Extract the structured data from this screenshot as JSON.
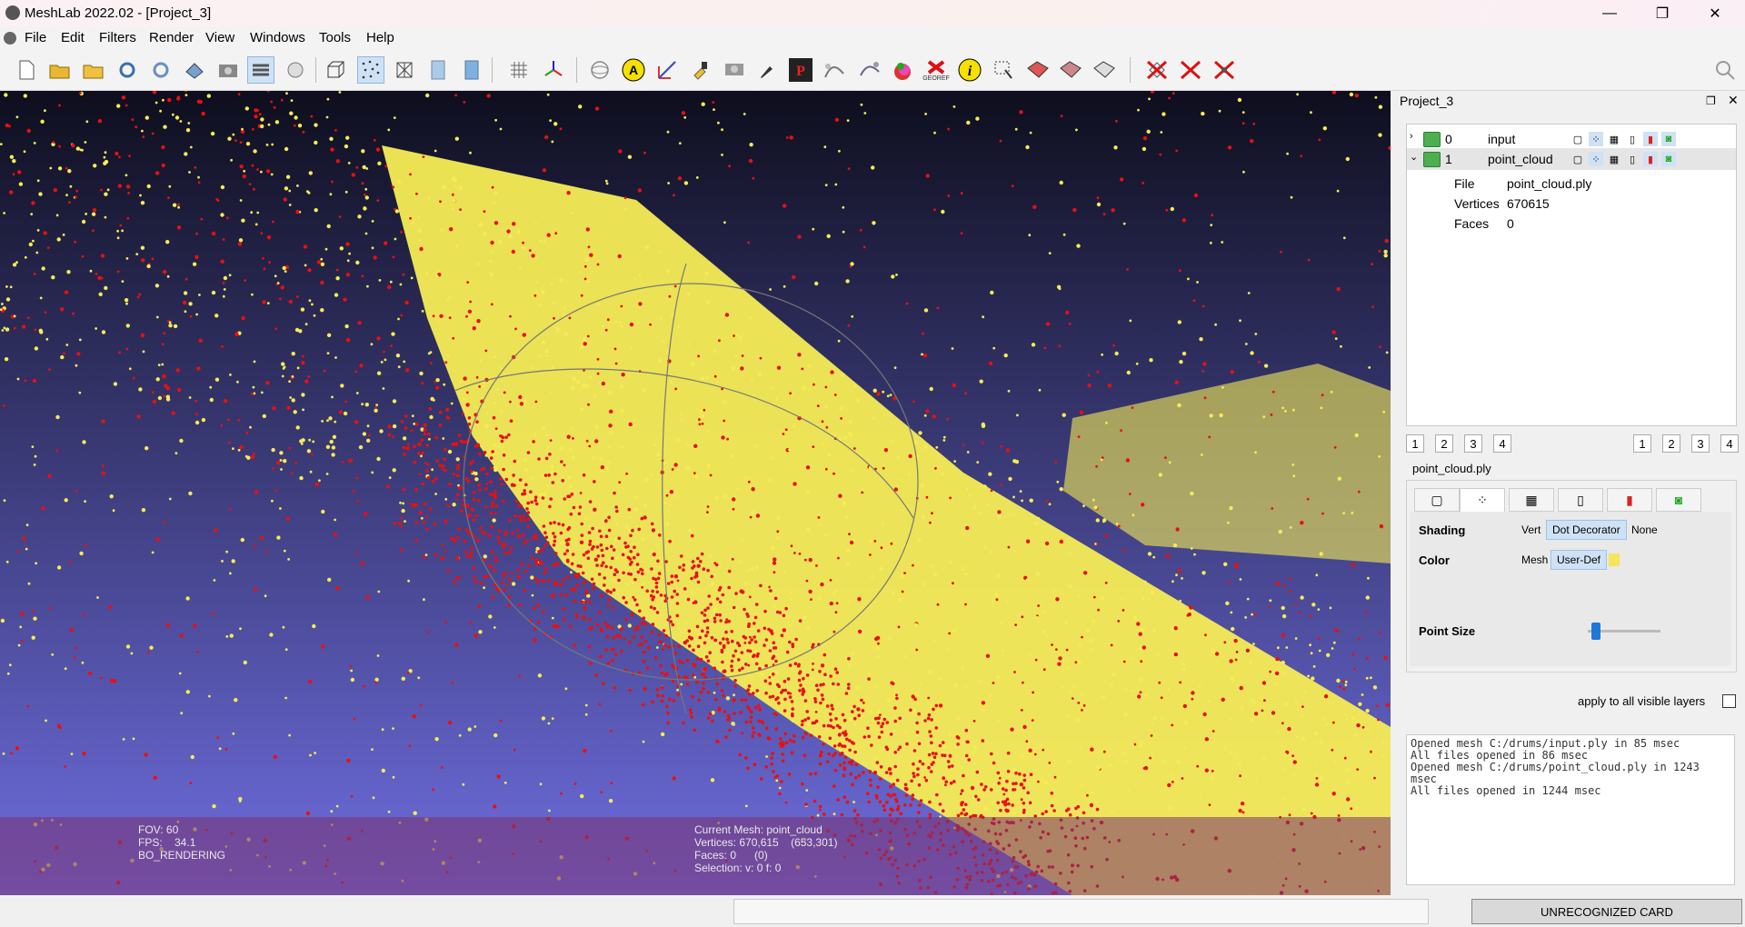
{
  "window": {
    "title": "MeshLab 2022.02 - [Project_3]",
    "minimize_glyph": "—",
    "maximize_glyph": "❐",
    "close_glyph": "✕"
  },
  "menu": [
    "File",
    "Edit",
    "Filters",
    "Render",
    "View",
    "Windows",
    "Tools",
    "Help"
  ],
  "toolbar": {
    "icons": [
      "new-project",
      "open-project",
      "open-mesh",
      "reload",
      "reload-all",
      "save",
      "snapshot",
      "layers",
      "ortho",
      "bbox",
      "points",
      "wireframe",
      "flat",
      "smooth",
      "texture",
      "axis",
      "trackball",
      "annotation",
      "measure",
      "paint",
      "align",
      "georef",
      "info",
      "select",
      "select-faces",
      "select-verts",
      "select-conn",
      "delete-faces",
      "delete-verts",
      "delete-all"
    ],
    "georef_label": "GEOREF"
  },
  "viewport": {
    "fov": "FOV: 60",
    "fps": "FPS:    34.1",
    "rendering": "BO_RENDERING",
    "current_mesh": "Current Mesh: point_cloud",
    "vertices": "Vertices: 670,615    (653,301)",
    "faces": "Faces: 0      (0)",
    "selection": "Selection: v: 0 f: 0"
  },
  "panel": {
    "title": "Project_3",
    "layers": [
      {
        "index": "0",
        "name": "input"
      },
      {
        "index": "1",
        "name": "point_cloud"
      }
    ],
    "details": [
      {
        "key": "File",
        "value": "point_cloud.ply"
      },
      {
        "key": "Vertices",
        "value": "670615"
      },
      {
        "key": "Faces",
        "value": "0"
      }
    ],
    "view_buttons_left": [
      "1",
      "2",
      "3",
      "4"
    ],
    "view_buttons_right": [
      "1",
      "2",
      "3",
      "4"
    ],
    "render_title": "point_cloud.ply",
    "shading_label": "Shading",
    "shading_options": [
      "Vert",
      "Dot Decorator",
      "None"
    ],
    "color_label": "Color",
    "color_options": [
      "Mesh",
      "User-Def"
    ],
    "point_size_label": "Point Size",
    "point_size_level": 0.05,
    "apply_all_label": "apply to all visible layers",
    "user_color": "#f5e55a"
  },
  "log": "Opened mesh C:/drums/input.ply in 85 msec\nAll files opened in 86 msec\nOpened mesh C:/drums/point_cloud.ply in 1243 msec\nAll files opened in 1244 msec",
  "status": {
    "card": "UNRECOGNIZED CARD"
  },
  "colors": {
    "points_yellow": "#f5ec55",
    "points_red": "#e81010",
    "bg_top": "#0e0e1e",
    "bg_bottom": "#6f6ee0"
  }
}
